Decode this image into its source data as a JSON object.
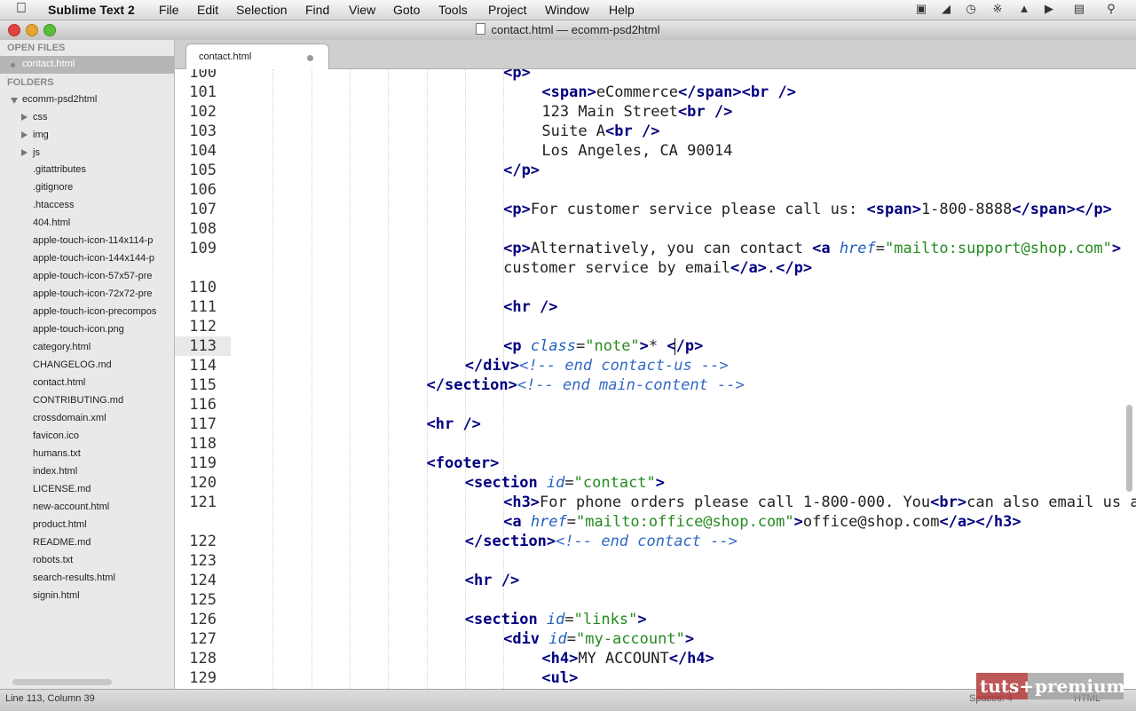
{
  "menubar": {
    "items": [
      "Sublime Text 2",
      "File",
      "Edit",
      "Selection",
      "Find",
      "View",
      "Goto",
      "Tools",
      "Project",
      "Window",
      "Help"
    ]
  },
  "window": {
    "title": "contact.html — ecomm-psd2html"
  },
  "sidebar": {
    "open_files_header": "OPEN FILES",
    "open_files": [
      "contact.html"
    ],
    "folders_header": "FOLDERS",
    "root": "ecomm-psd2html",
    "folders": [
      "css",
      "img",
      "js"
    ],
    "files": [
      ".gitattributes",
      ".gitignore",
      ".htaccess",
      "404.html",
      "apple-touch-icon-114x114-p",
      "apple-touch-icon-144x144-p",
      "apple-touch-icon-57x57-pre",
      "apple-touch-icon-72x72-pre",
      "apple-touch-icon-precompos",
      "apple-touch-icon.png",
      "category.html",
      "CHANGELOG.md",
      "contact.html",
      "CONTRIBUTING.md",
      "crossdomain.xml",
      "favicon.ico",
      "humans.txt",
      "index.html",
      "LICENSE.md",
      "new-account.html",
      "product.html",
      "README.md",
      "robots.txt",
      "search-results.html",
      "signin.html"
    ]
  },
  "tab": {
    "label": "contact.html"
  },
  "editor": {
    "current_line": "113",
    "lines": [
      {
        "n": "100",
        "ind": 7,
        "t": [
          [
            "tg",
            "<p>"
          ]
        ]
      },
      {
        "n": "101",
        "ind": 8,
        "t": [
          [
            "tg",
            "<span>"
          ],
          [
            "tx",
            "eCommerce"
          ],
          [
            "tg",
            "</span><br />"
          ]
        ]
      },
      {
        "n": "102",
        "ind": 8,
        "t": [
          [
            "tx",
            "123 Main Street"
          ],
          [
            "tg",
            "<br />"
          ]
        ]
      },
      {
        "n": "103",
        "ind": 8,
        "t": [
          [
            "tx",
            "Suite A"
          ],
          [
            "tg",
            "<br />"
          ]
        ]
      },
      {
        "n": "104",
        "ind": 8,
        "t": [
          [
            "tx",
            "Los Angeles, CA 90014"
          ]
        ]
      },
      {
        "n": "105",
        "ind": 7,
        "t": [
          [
            "tg",
            "</p>"
          ]
        ]
      },
      {
        "n": "106",
        "ind": 0,
        "t": []
      },
      {
        "n": "107",
        "ind": 7,
        "t": [
          [
            "tg",
            "<p>"
          ],
          [
            "tx",
            "For customer service please call us: "
          ],
          [
            "tg",
            "<span>"
          ],
          [
            "tx",
            "1-800-8888"
          ],
          [
            "tg",
            "</span></p>"
          ]
        ]
      },
      {
        "n": "108",
        "ind": 0,
        "t": []
      },
      {
        "n": "109",
        "ind": 7,
        "t": [
          [
            "tg",
            "<p>"
          ],
          [
            "tx",
            "Alternatively, you can contact "
          ],
          [
            "tg",
            "<a "
          ],
          [
            "at",
            "href"
          ],
          [
            "tx",
            "="
          ],
          [
            "st",
            "\"mailto:support@shop.com\""
          ],
          [
            "tg",
            ">"
          ]
        ]
      },
      {
        "n": "",
        "ind": 7,
        "t": [
          [
            "tx",
            "customer service by email"
          ],
          [
            "tg",
            "</a>"
          ],
          [
            "tx",
            "."
          ],
          [
            "tg",
            "</p>"
          ]
        ]
      },
      {
        "n": "110",
        "ind": 0,
        "t": []
      },
      {
        "n": "111",
        "ind": 7,
        "t": [
          [
            "tg",
            "<hr />"
          ]
        ]
      },
      {
        "n": "112",
        "ind": 0,
        "t": []
      },
      {
        "n": "113",
        "ind": 7,
        "t": [
          [
            "tg",
            "<p "
          ],
          [
            "at",
            "class"
          ],
          [
            "tx",
            "="
          ],
          [
            "st",
            "\"note\""
          ],
          [
            "tg",
            ">"
          ],
          [
            "tx",
            "* "
          ],
          [
            "tg",
            "</p>"
          ]
        ]
      },
      {
        "n": "114",
        "ind": 6,
        "t": [
          [
            "tg",
            "</div>"
          ],
          [
            "cm",
            "<!-- end contact-us -->"
          ]
        ]
      },
      {
        "n": "115",
        "ind": 5,
        "t": [
          [
            "tg",
            "</section>"
          ],
          [
            "cm",
            "<!-- end main-content -->"
          ]
        ]
      },
      {
        "n": "116",
        "ind": 0,
        "t": []
      },
      {
        "n": "117",
        "ind": 5,
        "t": [
          [
            "tg",
            "<hr />"
          ]
        ]
      },
      {
        "n": "118",
        "ind": 0,
        "t": []
      },
      {
        "n": "119",
        "ind": 5,
        "t": [
          [
            "tg",
            "<footer>"
          ]
        ]
      },
      {
        "n": "120",
        "ind": 6,
        "t": [
          [
            "tg",
            "<section "
          ],
          [
            "at",
            "id"
          ],
          [
            "tx",
            "="
          ],
          [
            "st",
            "\"contact\""
          ],
          [
            "tg",
            ">"
          ]
        ]
      },
      {
        "n": "121",
        "ind": 7,
        "t": [
          [
            "tg",
            "<h3>"
          ],
          [
            "tx",
            "For phone orders please call 1-800-000. You"
          ],
          [
            "tg",
            "<br>"
          ],
          [
            "tx",
            "can also email us at"
          ]
        ]
      },
      {
        "n": "",
        "ind": 7,
        "t": [
          [
            "tg",
            "<a "
          ],
          [
            "at",
            "href"
          ],
          [
            "tx",
            "="
          ],
          [
            "st",
            "\"mailto:office@shop.com\""
          ],
          [
            "tg",
            ">"
          ],
          [
            "tx",
            "office@shop.com"
          ],
          [
            "tg",
            "</a></h3>"
          ]
        ]
      },
      {
        "n": "122",
        "ind": 6,
        "t": [
          [
            "tg",
            "</section>"
          ],
          [
            "cm",
            "<!-- end contact -->"
          ]
        ]
      },
      {
        "n": "123",
        "ind": 0,
        "t": []
      },
      {
        "n": "124",
        "ind": 6,
        "t": [
          [
            "tg",
            "<hr />"
          ]
        ]
      },
      {
        "n": "125",
        "ind": 0,
        "t": []
      },
      {
        "n": "126",
        "ind": 6,
        "t": [
          [
            "tg",
            "<section "
          ],
          [
            "at",
            "id"
          ],
          [
            "tx",
            "="
          ],
          [
            "st",
            "\"links\""
          ],
          [
            "tg",
            ">"
          ]
        ]
      },
      {
        "n": "127",
        "ind": 7,
        "t": [
          [
            "tg",
            "<div "
          ],
          [
            "at",
            "id"
          ],
          [
            "tx",
            "="
          ],
          [
            "st",
            "\"my-account\""
          ],
          [
            "tg",
            ">"
          ]
        ]
      },
      {
        "n": "128",
        "ind": 8,
        "t": [
          [
            "tg",
            "<h4>"
          ],
          [
            "tx",
            "MY ACCOUNT"
          ],
          [
            "tg",
            "</h4>"
          ]
        ]
      },
      {
        "n": "129",
        "ind": 8,
        "t": [
          [
            "tg",
            "<ul>"
          ]
        ]
      }
    ]
  },
  "statusbar": {
    "position": "Line 113, Column 39",
    "spaces": "Spaces: 4",
    "syntax": "HTML"
  },
  "watermark": {
    "part1": "tuts+",
    "part2": "premium"
  }
}
